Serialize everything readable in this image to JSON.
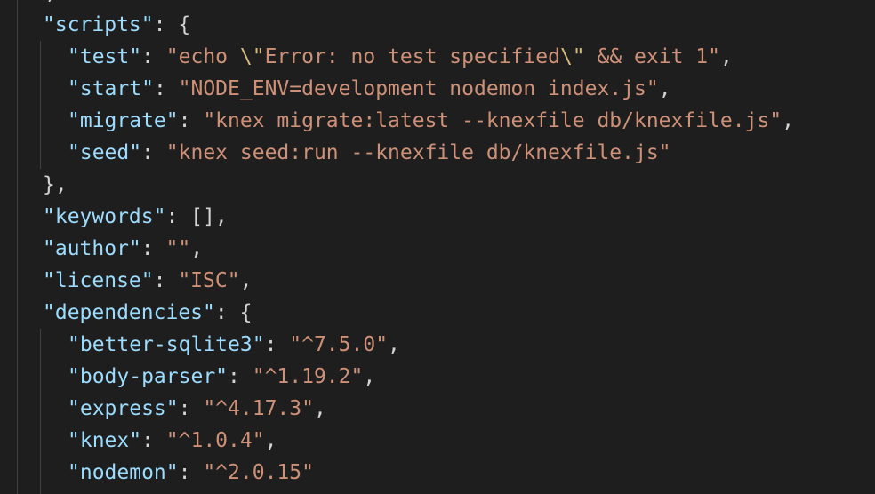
{
  "colors": {
    "background": "#1e1e1e",
    "key": "#9cdcfe",
    "string": "#ce9178",
    "escape": "#d7ba7d",
    "punctuation": "#d4d4d4",
    "indent_guide": "#404040"
  },
  "top_partial": ",",
  "lines": [
    {
      "indent": 1,
      "tokens": [
        {
          "t": "\"scripts\"",
          "c": "k"
        },
        {
          "t": ": {",
          "c": "p"
        }
      ]
    },
    {
      "indent": 2,
      "tokens": [
        {
          "t": "\"test\"",
          "c": "k"
        },
        {
          "t": ": ",
          "c": "p"
        },
        {
          "t": "\"echo ",
          "c": "s"
        },
        {
          "t": "\\\"",
          "c": "e"
        },
        {
          "t": "Error: no test specified",
          "c": "s"
        },
        {
          "t": "\\\"",
          "c": "e"
        },
        {
          "t": " && exit 1\"",
          "c": "s"
        },
        {
          "t": ",",
          "c": "p"
        }
      ]
    },
    {
      "indent": 2,
      "tokens": [
        {
          "t": "\"start\"",
          "c": "k"
        },
        {
          "t": ": ",
          "c": "p"
        },
        {
          "t": "\"NODE_ENV=development nodemon index.js\"",
          "c": "s"
        },
        {
          "t": ",",
          "c": "p"
        }
      ]
    },
    {
      "indent": 2,
      "tokens": [
        {
          "t": "\"migrate\"",
          "c": "k"
        },
        {
          "t": ": ",
          "c": "p"
        },
        {
          "t": "\"knex migrate:latest --knexfile db/knexfile.js\"",
          "c": "s"
        },
        {
          "t": ",",
          "c": "p"
        }
      ]
    },
    {
      "indent": 2,
      "tokens": [
        {
          "t": "\"seed\"",
          "c": "k"
        },
        {
          "t": ": ",
          "c": "p"
        },
        {
          "t": "\"knex seed:run --knexfile db/knexfile.js\"",
          "c": "s"
        }
      ]
    },
    {
      "indent": 1,
      "tokens": [
        {
          "t": "},",
          "c": "p"
        }
      ]
    },
    {
      "indent": 1,
      "tokens": [
        {
          "t": "\"keywords\"",
          "c": "k"
        },
        {
          "t": ": [],",
          "c": "p"
        }
      ]
    },
    {
      "indent": 1,
      "tokens": [
        {
          "t": "\"author\"",
          "c": "k"
        },
        {
          "t": ": ",
          "c": "p"
        },
        {
          "t": "\"\"",
          "c": "s"
        },
        {
          "t": ",",
          "c": "p"
        }
      ]
    },
    {
      "indent": 1,
      "tokens": [
        {
          "t": "\"license\"",
          "c": "k"
        },
        {
          "t": ": ",
          "c": "p"
        },
        {
          "t": "\"ISC\"",
          "c": "s"
        },
        {
          "t": ",",
          "c": "p"
        }
      ]
    },
    {
      "indent": 1,
      "tokens": [
        {
          "t": "\"dependencies\"",
          "c": "k"
        },
        {
          "t": ": {",
          "c": "p"
        }
      ]
    },
    {
      "indent": 2,
      "tokens": [
        {
          "t": "\"better-sqlite3\"",
          "c": "k"
        },
        {
          "t": ": ",
          "c": "p"
        },
        {
          "t": "\"^7.5.0\"",
          "c": "s"
        },
        {
          "t": ",",
          "c": "p"
        }
      ]
    },
    {
      "indent": 2,
      "tokens": [
        {
          "t": "\"body-parser\"",
          "c": "k"
        },
        {
          "t": ": ",
          "c": "p"
        },
        {
          "t": "\"^1.19.2\"",
          "c": "s"
        },
        {
          "t": ",",
          "c": "p"
        }
      ]
    },
    {
      "indent": 2,
      "tokens": [
        {
          "t": "\"express\"",
          "c": "k"
        },
        {
          "t": ": ",
          "c": "p"
        },
        {
          "t": "\"^4.17.3\"",
          "c": "s"
        },
        {
          "t": ",",
          "c": "p"
        }
      ]
    },
    {
      "indent": 2,
      "tokens": [
        {
          "t": "\"knex\"",
          "c": "k"
        },
        {
          "t": ": ",
          "c": "p"
        },
        {
          "t": "\"^1.0.4\"",
          "c": "s"
        },
        {
          "t": ",",
          "c": "p"
        }
      ]
    },
    {
      "indent": 2,
      "tokens": [
        {
          "t": "\"nodemon\"",
          "c": "k"
        },
        {
          "t": ": ",
          "c": "p"
        },
        {
          "t": "\"^2.0.15\"",
          "c": "s"
        }
      ]
    }
  ]
}
